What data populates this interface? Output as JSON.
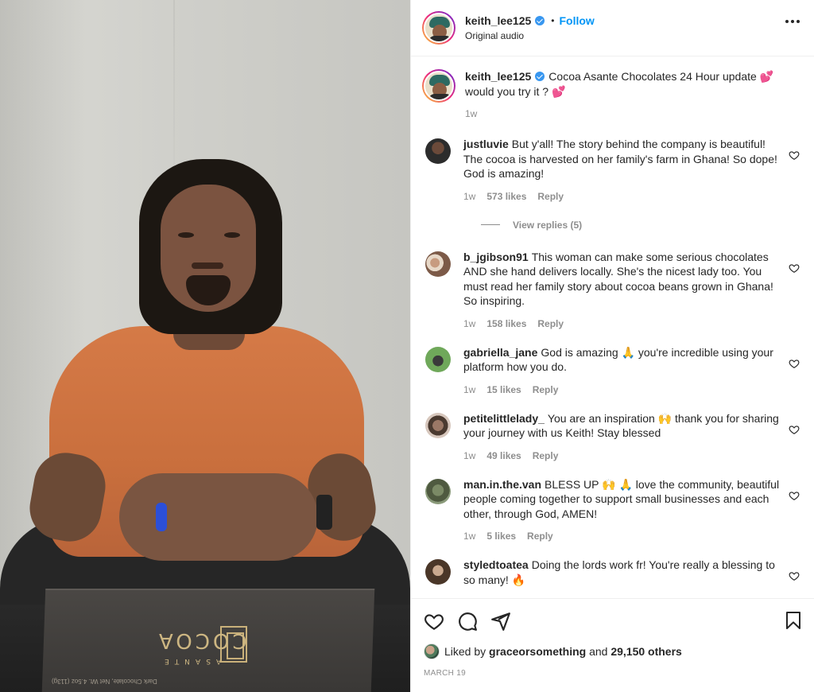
{
  "header": {
    "username": "keith_lee125",
    "follow_label": "Follow",
    "dot": "•",
    "audio_label": "Original audio"
  },
  "media": {
    "box_brand": "COCOA",
    "box_subbrand": "ASANTE",
    "box_fine_print": "Dark Chocolate, Net Wt. 4.5oz (113g)"
  },
  "caption": {
    "username": "keith_lee125",
    "text": "Cocoa Asante Chocolates 24 Hour update 💕 would you try it ? 💕",
    "time": "1w"
  },
  "comments": [
    {
      "username": "justluvie",
      "text": "But y'all! The story behind the company is beautiful! The cocoa is harvested on her family's farm in Ghana! So dope! God is amazing!",
      "time": "1w",
      "likes": "573 likes",
      "reply_label": "Reply",
      "avatar_color": "#3a3a3a",
      "view_replies": "View replies (5)"
    },
    {
      "username": "b_jgibson91",
      "text": "This woman can make some serious chocolates AND she hand delivers locally. She's the nicest lady too. You must read her family story about cocoa beans grown in Ghana! So inspiring.",
      "time": "1w",
      "likes": "158 likes",
      "reply_label": "Reply",
      "avatar_color": "#b58a73"
    },
    {
      "username": "gabriella_jane",
      "text": "God is amazing 🙏 you're incredible using your platform how you do.",
      "time": "1w",
      "likes": "15 likes",
      "reply_label": "Reply",
      "avatar_color": "#5c8f4a"
    },
    {
      "username": "petitelittlelady_",
      "text": "You are an inspiration 🙌 thank you for sharing your journey with us Keith! Stay blessed",
      "time": "1w",
      "likes": "49 likes",
      "reply_label": "Reply",
      "avatar_color": "#6b5546"
    },
    {
      "username": "man.in.the.van",
      "text": "BLESS UP 🙌 🙏 love the community, beautiful people coming together to support small businesses and each other, through God, AMEN!",
      "time": "1w",
      "likes": "5 likes",
      "reply_label": "Reply",
      "avatar_color": "#6f7a5a"
    },
    {
      "username": "styledtoatea",
      "text": "Doing the lords work fr! You're really a blessing to so many! 🔥",
      "avatar_color": "#5a4636"
    }
  ],
  "actions": {
    "icons": [
      "heart-icon",
      "comment-icon",
      "share-icon",
      "bookmark-icon"
    ],
    "liked_by_prefix": "Liked by",
    "liked_by_user": "graceorsomething",
    "liked_by_and": "and",
    "liked_by_count": "29,150 others",
    "date": "MARCH 19"
  },
  "colors": {
    "link_blue": "#0095f6",
    "verified_blue": "#3897f0",
    "muted_text": "#8e8e8e",
    "shirt_orange": "#d57a47"
  }
}
